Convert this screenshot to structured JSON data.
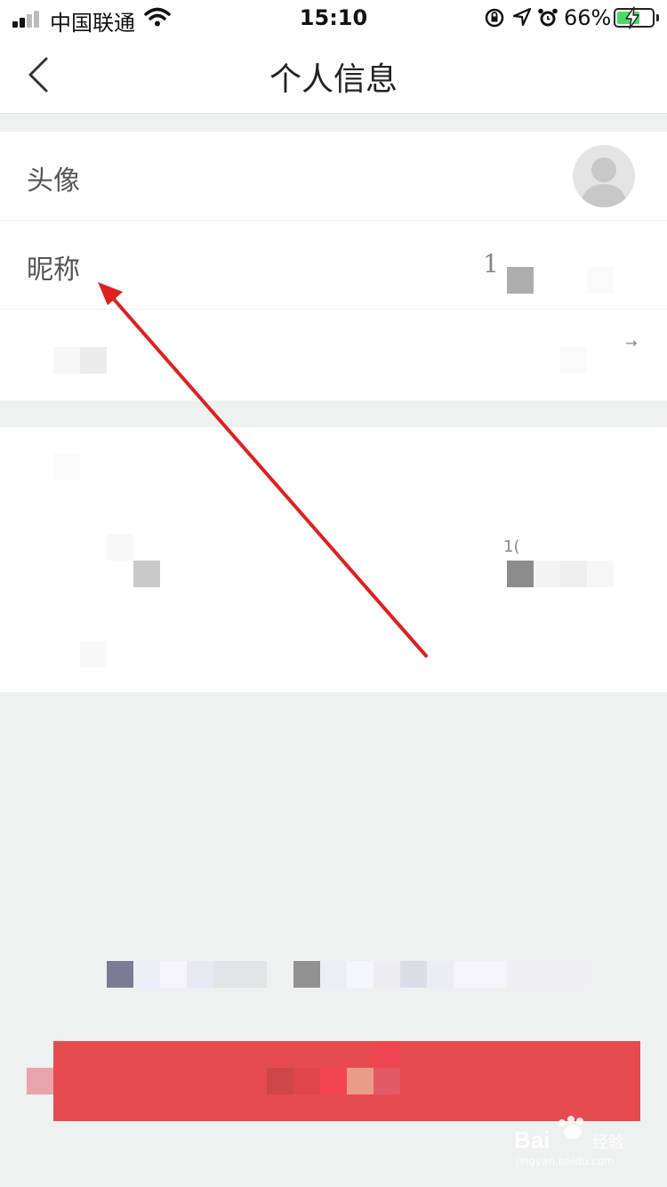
{
  "status_bar": {
    "carrier": "中国联通",
    "time": "15:10",
    "battery_percent": "66%",
    "battery_level": 0.66,
    "icons": [
      "signal-icon",
      "wifi-icon",
      "rotation-lock-icon",
      "location-icon",
      "alarm-icon",
      "battery-icon",
      "charging-icon"
    ]
  },
  "nav": {
    "title": "个人信息",
    "back_icon": "chevron-left-icon"
  },
  "profile": {
    "avatar_label": "头像",
    "nickname_label": "昵称",
    "nickname_value": "1"
  },
  "section2": {
    "fragment": "1("
  },
  "annotation": {
    "arrow_color": "#e02020"
  },
  "logout_button": {
    "color": "#e64b4f"
  },
  "watermark": {
    "brand": "Bai",
    "brand2": "经验",
    "url": "jingyan.baidu.com"
  }
}
